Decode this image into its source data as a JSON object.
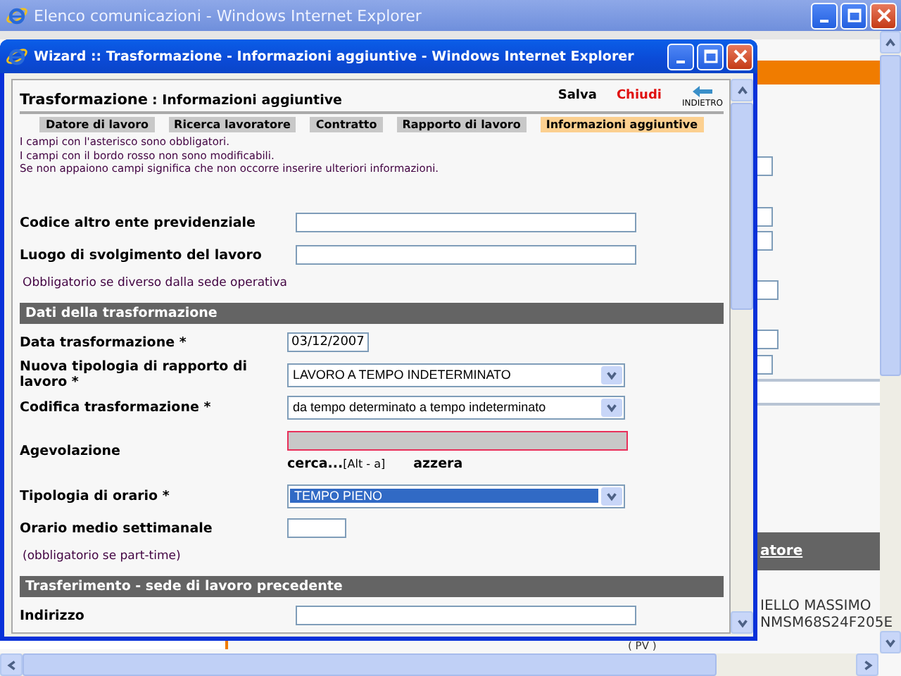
{
  "back_window": {
    "title": "Elenco comunicazioni - Windows Internet Explorer",
    "header_link": "atore",
    "worker_name": "IELLO MASSIMO",
    "worker_code": "NMSM68S24F205E",
    "province": "( PV )"
  },
  "wizard_window": {
    "title": "Wizard :: Trasformazione - Informazioni aggiuntive - Windows Internet Explorer",
    "page_title": "Trasformazione",
    "page_subtitle": ": Informazioni aggiuntive",
    "actions": [
      {
        "label": "Salva",
        "kind": "save"
      },
      {
        "label": "Chiudi",
        "kind": "close"
      }
    ],
    "back_button": {
      "label": "INDIETRO"
    },
    "steps": [
      {
        "label": "Datore di lavoro",
        "selected": false
      },
      {
        "label": "Ricerca lavoratore",
        "selected": false
      },
      {
        "label": "Contratto",
        "selected": false
      },
      {
        "label": "Rapporto di lavoro",
        "selected": false
      },
      {
        "label": "Informazioni aggiuntive",
        "selected": true
      }
    ],
    "notes": [
      "I campi con l'asterisco sono obbligatori.",
      "I campi con il bordo rosso non sono modificabili.",
      "Se non appaiono campi significa che non occorre inserire ulteriori informazioni."
    ],
    "form": [
      {
        "kind": "text",
        "label": "Codice altro ente previdenziale"
      },
      {
        "kind": "text",
        "label": "Luogo di svolgimento del lavoro"
      },
      {
        "kind": "note",
        "text": "Obbligatorio se diverso dalla sede operativa"
      },
      {
        "kind": "section",
        "text": "Dati della trasformazione"
      },
      {
        "kind": "date",
        "label": "Data trasformazione *",
        "value": "03/12/2007"
      },
      {
        "kind": "select",
        "label": "Nuova tipologia di rapporto di lavoro *",
        "value": "LAVORO A TEMPO INDETERMINATO",
        "focused": false
      },
      {
        "kind": "select",
        "label": "Codifica trasformazione *",
        "value": "da tempo determinato a tempo indeterminato",
        "focused": false
      },
      {
        "kind": "lookup",
        "label": "Agevolazione",
        "search_link": "cerca...",
        "shortcut": "[Alt - a]",
        "clear_link": "azzera"
      },
      {
        "kind": "select",
        "label": "Tipologia di orario *",
        "value": "TEMPO PIENO",
        "focused": true
      },
      {
        "kind": "hours",
        "label": "Orario medio settimanale"
      },
      {
        "kind": "note",
        "text": "(obbligatorio se part-time)"
      },
      {
        "kind": "section",
        "text": "Trasferimento - sede di lavoro precedente"
      },
      {
        "kind": "text",
        "label": "Indirizzo"
      }
    ]
  }
}
